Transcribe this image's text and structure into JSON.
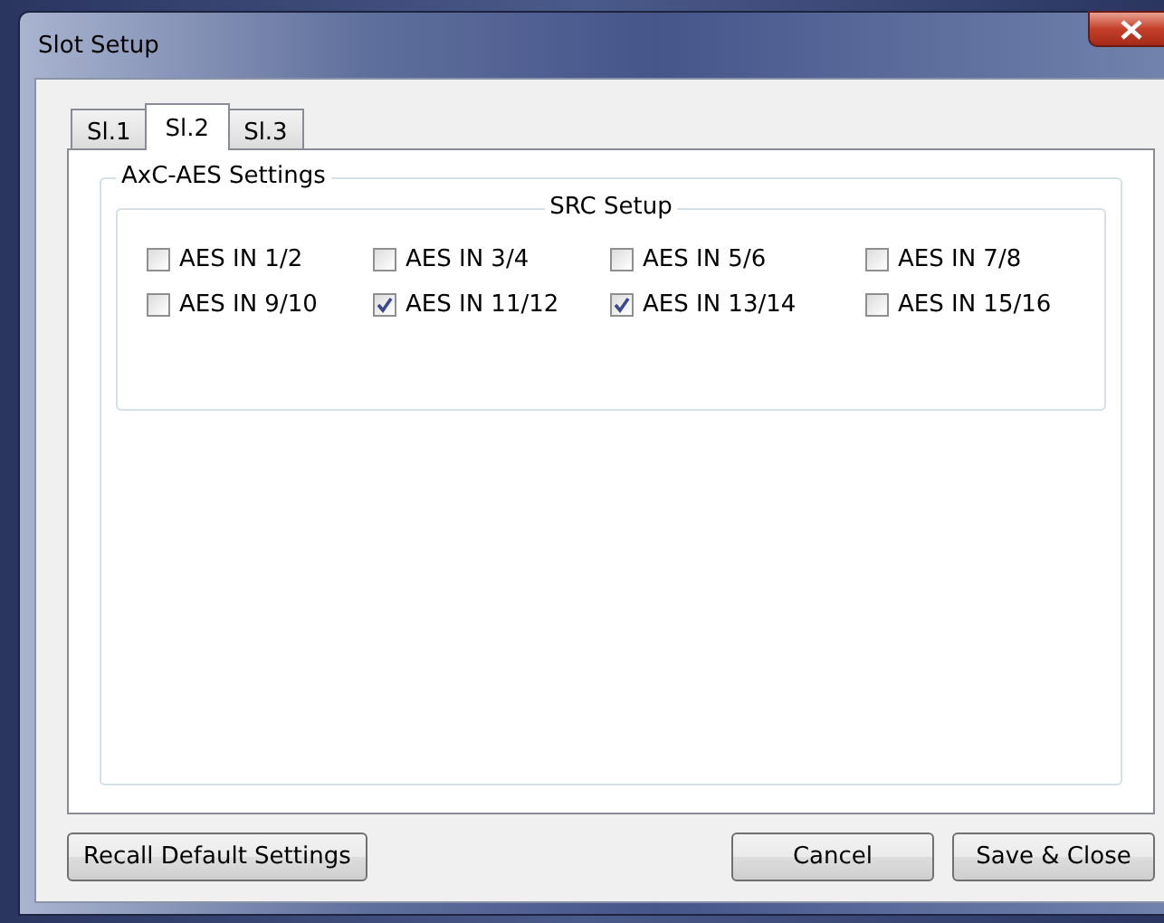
{
  "window": {
    "title": "Slot Setup"
  },
  "tabs": [
    {
      "label": "Sl.1",
      "selected": false
    },
    {
      "label": "Sl.2",
      "selected": true
    },
    {
      "label": "Sl.3",
      "selected": false
    }
  ],
  "group": {
    "title": "AxC-AES Settings"
  },
  "src_setup": {
    "title": "SRC Setup",
    "checkboxes": [
      {
        "label": "AES IN 1/2",
        "checked": false
      },
      {
        "label": "AES IN 3/4",
        "checked": false
      },
      {
        "label": "AES IN 5/6",
        "checked": false
      },
      {
        "label": "AES IN 7/8",
        "checked": false
      },
      {
        "label": "AES IN 9/10",
        "checked": false
      },
      {
        "label": "AES IN 11/12",
        "checked": true
      },
      {
        "label": "AES IN 13/14",
        "checked": true
      },
      {
        "label": "AES IN 15/16",
        "checked": false
      }
    ]
  },
  "buttons": {
    "left": "Recall Default Settings",
    "cancel": "Cancel",
    "save": "Save & Close"
  }
}
